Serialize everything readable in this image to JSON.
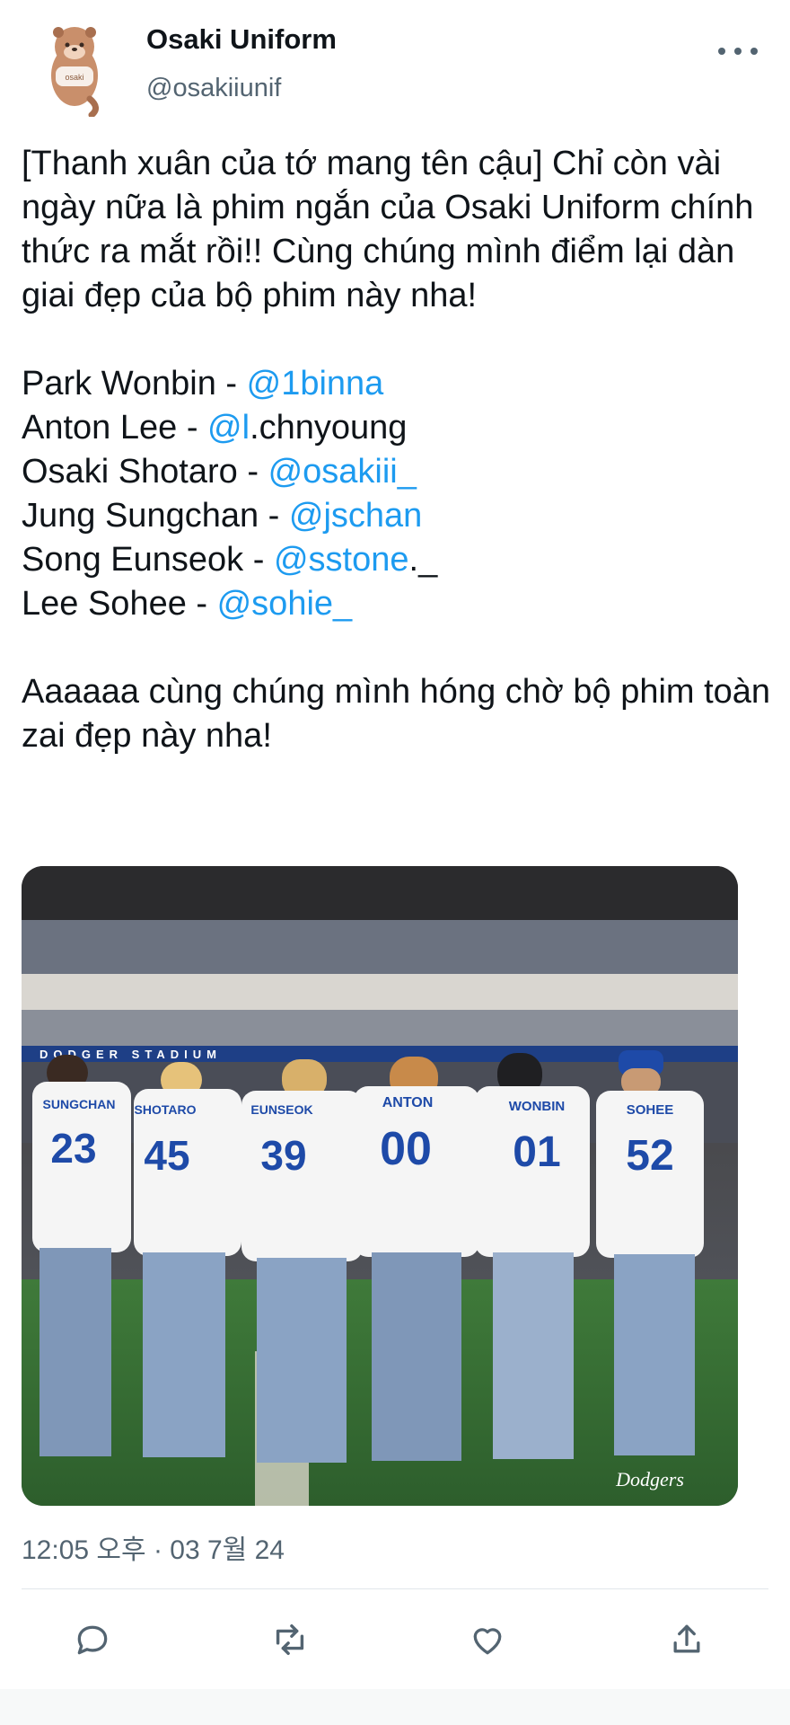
{
  "author": {
    "display_name": "Osaki Uniform",
    "handle": "@osakiiunif",
    "avatar_icon": "otter-avatar-icon"
  },
  "tweet": {
    "intro": "[Thanh xuân của tớ mang tên cậu] Chỉ còn vài ngày nữa là phim ngắn của Osaki Uniform chính thức ra mắt rồi!! Cùng chúng mình điểm lại dàn giai đẹp của bộ phim này nha!",
    "cast": [
      {
        "name": "Park Wonbin - ",
        "mention": "@1binna",
        "suffix": ""
      },
      {
        "name": "Anton Lee - ",
        "mention": "@l",
        "suffix": ".chnyoung"
      },
      {
        "name": "Osaki Shotaro - ",
        "mention": "@osakiii_",
        "suffix": ""
      },
      {
        "name": "Jung Sungchan - ",
        "mention": "@jschan",
        "suffix": ""
      },
      {
        "name": "Song Eunseok - ",
        "mention": "@sstone",
        "suffix": "._"
      },
      {
        "name": "Lee Sohee - ",
        "mention": "@sohie_",
        "suffix": ""
      }
    ],
    "outro": "Aaaaaa cùng chúng mình hóng chờ bộ phim toàn zai đẹp này nha!",
    "timestamp": "12:05 오후 · 03 7월 24"
  },
  "photo": {
    "stadium_sign": "DODGER STADIUM",
    "watermark": "Dodgers",
    "jerseys": [
      {
        "name": "SUNGCHAN",
        "number": "23"
      },
      {
        "name": "SHOTARO",
        "number": "45"
      },
      {
        "name": "EUNSEOK",
        "number": "39"
      },
      {
        "name": "ANTON",
        "number": "00"
      },
      {
        "name": "WONBIN",
        "number": "01"
      },
      {
        "name": "SOHEE",
        "number": "52"
      }
    ]
  },
  "actions": {
    "reply_icon": "reply-icon",
    "retweet_icon": "retweet-icon",
    "like_icon": "heart-icon",
    "share_icon": "share-icon"
  },
  "colors": {
    "link": "#1d9bf0",
    "secondary_text": "#536471",
    "jersey_blue": "#1e4aa8"
  }
}
